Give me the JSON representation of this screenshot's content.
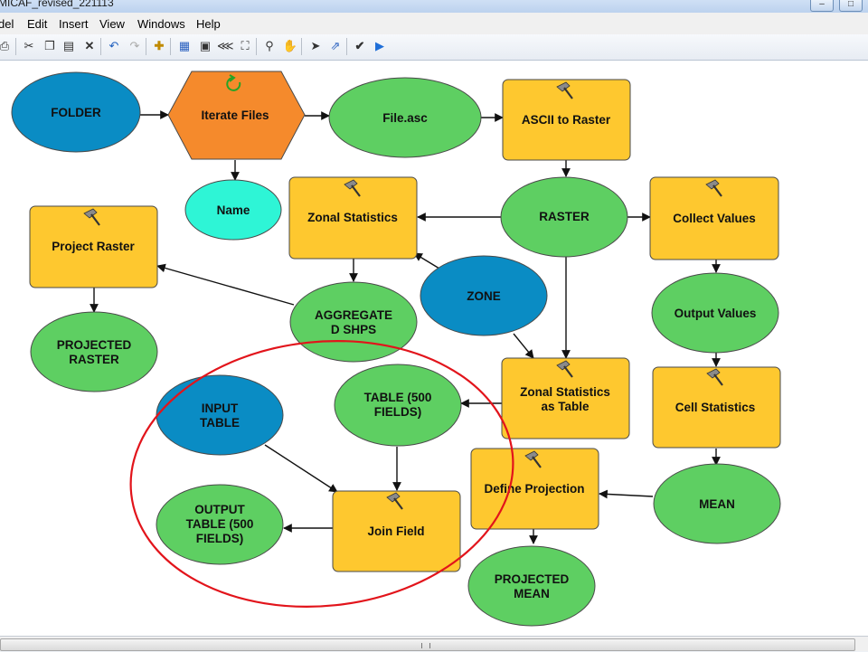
{
  "window": {
    "title": "MICAF_revised_221113"
  },
  "menu": [
    "del",
    "Edit",
    "Insert",
    "View",
    "Windows",
    "Help"
  ],
  "toolbar": {
    "icons": [
      "print-icon",
      "cut-icon",
      "copy-icon",
      "paste-icon",
      "delete-icon",
      "undo-icon",
      "redo-icon",
      "add-data-icon",
      "auto-layout-icon",
      "full-extent-icon",
      "zoom-fixed-in-icon",
      "zoom-fixed-out-icon",
      "zoom-in-icon",
      "pan-icon",
      "select-icon",
      "connect-icon",
      "validate-icon",
      "run-icon"
    ]
  },
  "model": {
    "nodes": [
      {
        "id": "folder",
        "label": [
          "FOLDER"
        ],
        "kind": "input"
      },
      {
        "id": "iterate",
        "label": [
          "Iterate Files"
        ],
        "kind": "iterator"
      },
      {
        "id": "file_asc",
        "label": [
          "File.asc"
        ],
        "kind": "data"
      },
      {
        "id": "ascii_to_raster",
        "label": [
          "ASCII to Raster"
        ],
        "kind": "tool"
      },
      {
        "id": "name",
        "label": [
          "Name"
        ],
        "kind": "value"
      },
      {
        "id": "zonal_stats",
        "label": [
          "Zonal Statistics"
        ],
        "kind": "tool"
      },
      {
        "id": "raster",
        "label": [
          "RASTER"
        ],
        "kind": "data"
      },
      {
        "id": "collect_values",
        "label": [
          "Collect Values"
        ],
        "kind": "tool"
      },
      {
        "id": "project_raster",
        "label": [
          "Project Raster"
        ],
        "kind": "tool"
      },
      {
        "id": "zone",
        "label": [
          "ZONE"
        ],
        "kind": "input"
      },
      {
        "id": "aggregated_shps",
        "label": [
          "AGGREGATE",
          "D SHPS"
        ],
        "kind": "data"
      },
      {
        "id": "output_values",
        "label": [
          "Output Values"
        ],
        "kind": "data"
      },
      {
        "id": "projected_raster",
        "label": [
          "PROJECTED",
          "RASTER"
        ],
        "kind": "data"
      },
      {
        "id": "input_table",
        "label": [
          "INPUT",
          "TABLE"
        ],
        "kind": "input"
      },
      {
        "id": "table_500",
        "label": [
          "TABLE (500",
          "FIELDS)"
        ],
        "kind": "data"
      },
      {
        "id": "zonal_stats_table",
        "label": [
          "Zonal Statistics",
          "as Table"
        ],
        "kind": "tool"
      },
      {
        "id": "cell_statistics",
        "label": [
          "Cell Statistics"
        ],
        "kind": "tool"
      },
      {
        "id": "define_projection",
        "label": [
          "Define Projection"
        ],
        "kind": "tool"
      },
      {
        "id": "mean",
        "label": [
          "MEAN"
        ],
        "kind": "data"
      },
      {
        "id": "output_table",
        "label": [
          "OUTPUT",
          "TABLE (500",
          "FIELDS)"
        ],
        "kind": "data"
      },
      {
        "id": "join_field",
        "label": [
          "Join Field"
        ],
        "kind": "tool"
      },
      {
        "id": "projected_mean",
        "label": [
          "PROJECTED",
          "MEAN"
        ],
        "kind": "data"
      }
    ],
    "connections": [
      [
        "folder",
        "iterate"
      ],
      [
        "iterate",
        "file_asc"
      ],
      [
        "file_asc",
        "ascii_to_raster"
      ],
      [
        "iterate",
        "name"
      ],
      [
        "ascii_to_raster",
        "raster"
      ],
      [
        "raster",
        "zonal_stats"
      ],
      [
        "raster",
        "collect_values"
      ],
      [
        "zone",
        "zonal_stats"
      ],
      [
        "zonal_stats",
        "aggregated_shps"
      ],
      [
        "aggregated_shps",
        "project_raster"
      ],
      [
        "project_raster",
        "projected_raster"
      ],
      [
        "collect_values",
        "output_values"
      ],
      [
        "zone",
        "zonal_stats_table"
      ],
      [
        "raster",
        "zonal_stats_table"
      ],
      [
        "zonal_stats_table",
        "table_500"
      ],
      [
        "output_values",
        "cell_statistics"
      ],
      [
        "cell_statistics",
        "mean"
      ],
      [
        "mean",
        "define_projection"
      ],
      [
        "define_projection",
        "projected_mean"
      ],
      [
        "input_table",
        "join_field"
      ],
      [
        "table_500",
        "join_field"
      ],
      [
        "join_field",
        "output_table"
      ]
    ]
  },
  "colors": {
    "input": "#0a8cc4",
    "data": "#5ecf62",
    "tool": "#fec82f",
    "iterator": "#f58a2c",
    "value": "#2ef5d6",
    "outline": "#4a4a4a",
    "highlight": "#e2141b"
  },
  "annotation": {
    "shape": "ellipse",
    "color": "#e2141b",
    "encloses": [
      "input_table",
      "table_500",
      "join_field",
      "output_table"
    ]
  }
}
